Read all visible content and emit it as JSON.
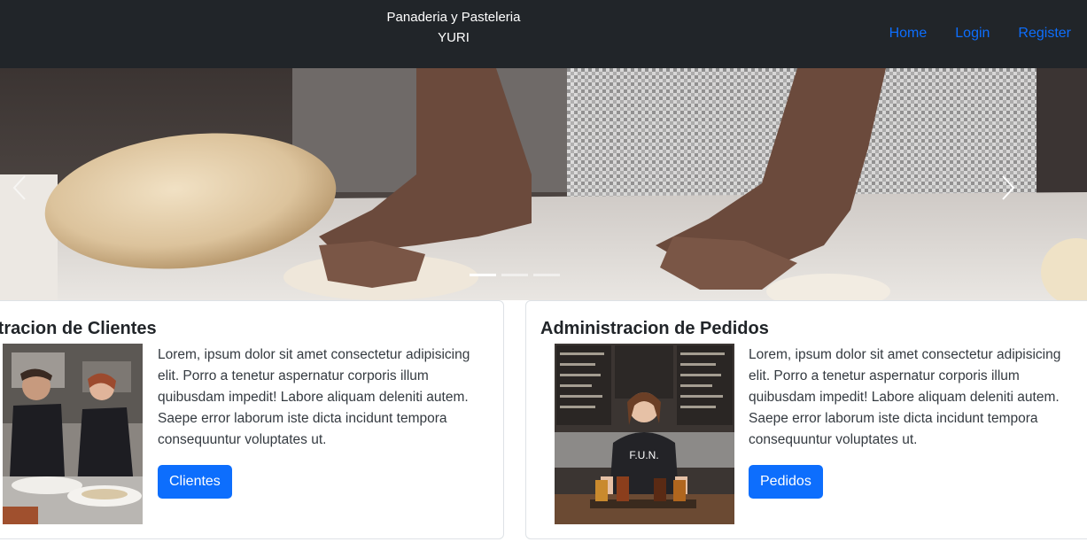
{
  "navbar": {
    "brand_line1": "Panaderia y Pasteleria",
    "brand_line2": "YURI",
    "links": [
      {
        "label": "Home"
      },
      {
        "label": "Login"
      },
      {
        "label": "Register"
      }
    ],
    "link_color": "#0d6efd",
    "background": "#212529"
  },
  "carousel": {
    "prev_icon": "chevron-left-icon",
    "next_icon": "chevron-right-icon",
    "slide_count": 3,
    "active_slide": 1
  },
  "cards": [
    {
      "title": "istracion de Clientes",
      "text": "Lorem, ipsum dolor sit amet consectetur adipisicing elit. Porro a tenetur aspernatur corporis illum quibusdam impedit! Labore aliquam deleniti autem. Saepe error laborum iste dicta incidunt tempora consequuntur voluptates ut.",
      "button_label": "Clientes"
    },
    {
      "title": "Administracion de Pedidos",
      "text": "Lorem, ipsum dolor sit amet consectetur adipisicing elit. Porro a tenetur aspernatur corporis illum quibusdam impedit! Labore aliquam deleniti autem. Saepe error laborum iste dicta incidunt tempora consequuntur voluptates ut.",
      "button_label": "Pedidos"
    }
  ]
}
